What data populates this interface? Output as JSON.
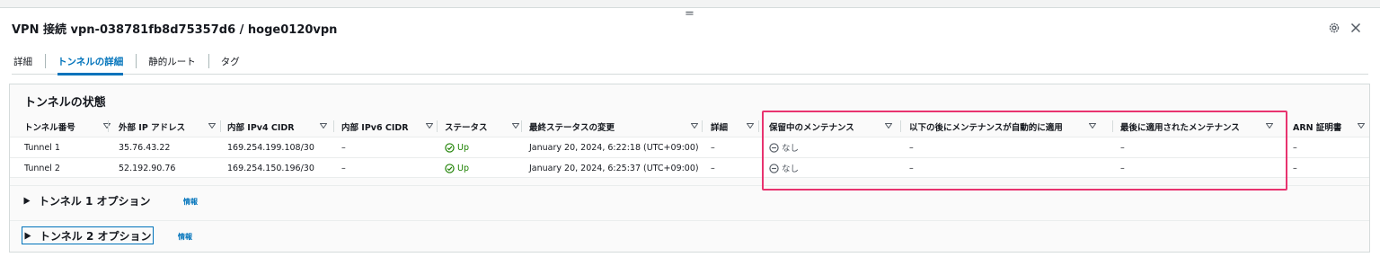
{
  "page": {
    "title": "VPN 接続 vpn-038781fb8d75357d6 / hoge0120vpn",
    "drag_handle": "="
  },
  "tabs": [
    {
      "label": "詳細",
      "active": false
    },
    {
      "label": "トンネルの詳細",
      "active": true
    },
    {
      "label": "静的ルート",
      "active": false
    },
    {
      "label": "タグ",
      "active": false
    }
  ],
  "panel": {
    "title": "トンネルの状態",
    "columns": [
      "トンネル番号",
      "外部 IP アドレス",
      "内部 IPv4 CIDR",
      "内部 IPv6 CIDR",
      "ステータス",
      "最終ステータスの変更",
      "詳細",
      "保留中のメンテナンス",
      "以下の後にメンテナンスが自動的に適用",
      "最後に適用されたメンテナンス",
      "ARN 証明書"
    ],
    "rows": [
      {
        "tunnel": "Tunnel 1",
        "outside_ip": "35.76.43.22",
        "inside_ipv4": "169.254.199.108/30",
        "inside_ipv6": "–",
        "status": "Up",
        "last_status_change": "January 20, 2024, 6:22:18 (UTC+09:00)",
        "details": "–",
        "pending_maintenance": "なし",
        "maintenance_auto_applied_after": "–",
        "last_maintenance_applied": "–",
        "certificate_arn": "–"
      },
      {
        "tunnel": "Tunnel 2",
        "outside_ip": "52.192.90.76",
        "inside_ipv4": "169.254.150.196/30",
        "inside_ipv6": "–",
        "status": "Up",
        "last_status_change": "January 20, 2024, 6:25:37 (UTC+09:00)",
        "details": "–",
        "pending_maintenance": "なし",
        "maintenance_auto_applied_after": "–",
        "last_maintenance_applied": "–",
        "certificate_arn": "–"
      }
    ]
  },
  "expanders": [
    {
      "label": "トンネル 1 オプション",
      "info": "情報"
    },
    {
      "label": "トンネル 2 オプション",
      "info": "情報"
    }
  ],
  "icons": {
    "settings": "gear-icon",
    "close": "close-icon",
    "sort": "caret-down-icon",
    "status_ok": "check-circle-icon",
    "none": "minus-circle-icon",
    "expand": "caret-right-icon"
  },
  "colors": {
    "link_blue": "#0073bb",
    "success_green": "#1d8102",
    "highlight_pink": "#e8336f",
    "text": "#16191f"
  }
}
